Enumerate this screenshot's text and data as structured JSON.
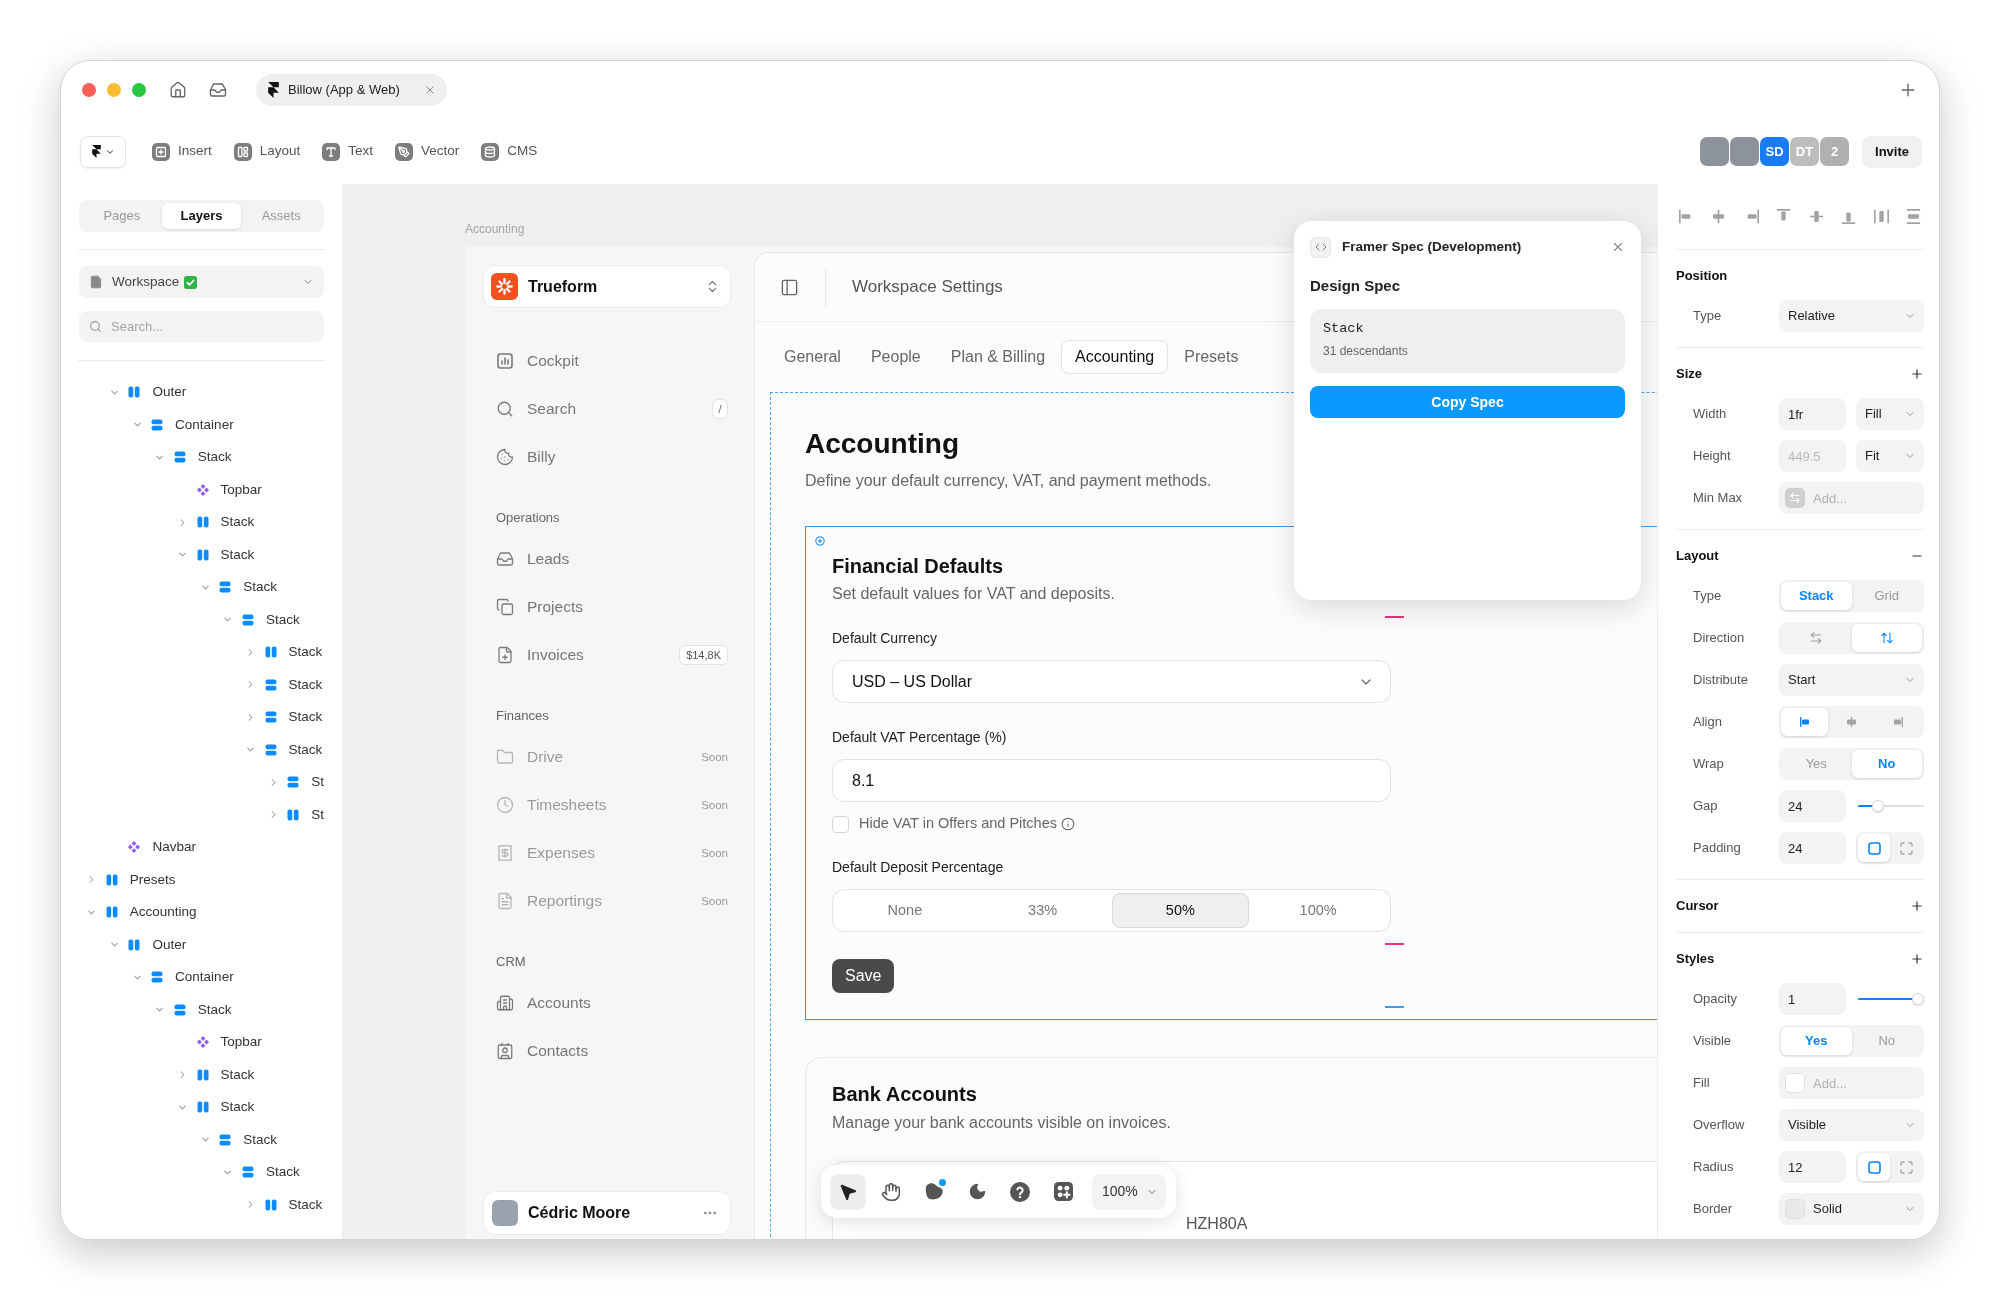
{
  "window": {
    "tab": {
      "title": "Billow (App & Web)"
    }
  },
  "toolbar": {
    "items": [
      {
        "label": "Insert"
      },
      {
        "label": "Layout"
      },
      {
        "label": "Text"
      },
      {
        "label": "Vector"
      },
      {
        "label": "CMS"
      }
    ],
    "collaborators": [
      {
        "kind": "photo"
      },
      {
        "kind": "photo"
      },
      {
        "kind": "initials",
        "label": "SD",
        "color": "#1a7cf5"
      },
      {
        "kind": "initials",
        "label": "DT",
        "color": "#bdbdbd"
      },
      {
        "kind": "count",
        "label": "2",
        "color": "#b0b0b0"
      }
    ],
    "invite": "Invite"
  },
  "left_panel": {
    "tabs": [
      {
        "label": "Pages",
        "selected": false
      },
      {
        "label": "Layers",
        "selected": true
      },
      {
        "label": "Assets",
        "selected": false
      }
    ],
    "page": {
      "value": "Workspace"
    },
    "search": {
      "placeholder": "Search..."
    },
    "layers": [
      {
        "children": [
          {
            "name": "Outer",
            "kind": "hstack",
            "expanded": true,
            "children": [
              {
                "name": "Container",
                "kind": "vstack",
                "expanded": true,
                "children": [
                  {
                    "name": "Stack",
                    "kind": "vstack",
                    "expanded": true,
                    "children": [
                      {
                        "name": "Topbar",
                        "kind": "component"
                      },
                      {
                        "name": "Stack",
                        "kind": "hstack",
                        "expanded": false
                      },
                      {
                        "name": "Stack",
                        "kind": "hstack",
                        "expanded": true,
                        "children": [
                          {
                            "name": "Stack",
                            "kind": "vstack",
                            "expanded": true,
                            "children": [
                              {
                                "name": "Stack",
                                "kind": "vstack",
                                "expanded": true,
                                "children": [
                                  {
                                    "name": "Stack",
                                    "kind": "hstack",
                                    "expanded": false
                                  },
                                  {
                                    "name": "Stack",
                                    "kind": "vstack",
                                    "expanded": false
                                  },
                                  {
                                    "name": "Stack",
                                    "kind": "vstack",
                                    "expanded": false
                                  },
                                  {
                                    "name": "Stack",
                                    "kind": "vstack",
                                    "expanded": true,
                                    "children": [
                                      {
                                        "name": "St",
                                        "kind": "vstack",
                                        "expanded": false
                                      },
                                      {
                                        "name": "St",
                                        "kind": "hstack",
                                        "expanded": false
                                      }
                                    ]
                                  }
                                ]
                              }
                            ]
                          }
                        ]
                      }
                    ]
                  }
                ]
              }
            ]
          },
          {
            "name": "Navbar",
            "kind": "component"
          }
        ]
      },
      {
        "name": "Presets",
        "kind": "hstack",
        "expanded": false
      },
      {
        "name": "Accounting",
        "kind": "hstack",
        "expanded": true,
        "children": [
          {
            "name": "Outer",
            "kind": "hstack",
            "expanded": true,
            "children": [
              {
                "name": "Container",
                "kind": "vstack",
                "expanded": true,
                "children": [
                  {
                    "name": "Stack",
                    "kind": "vstack",
                    "expanded": true,
                    "children": [
                      {
                        "name": "Topbar",
                        "kind": "component"
                      },
                      {
                        "name": "Stack",
                        "kind": "hstack",
                        "expanded": false
                      },
                      {
                        "name": "Stack",
                        "kind": "hstack",
                        "expanded": true,
                        "children": [
                          {
                            "name": "Stack",
                            "kind": "vstack",
                            "expanded": true,
                            "children": [
                              {
                                "name": "Stack",
                                "kind": "vstack",
                                "expanded": true,
                                "children": [
                                  {
                                    "name": "Stack",
                                    "kind": "hstack",
                                    "expanded": false
                                  }
                                ]
                              }
                            ]
                          }
                        ]
                      }
                    ]
                  }
                ]
              }
            ]
          }
        ]
      }
    ]
  },
  "canvas": {
    "frame_label": "Accounting",
    "app": {
      "sidebar": {
        "workspace": "Trueform",
        "sections": [
          {
            "items": [
              {
                "label": "Cockpit",
                "disabled": false
              },
              {
                "label": "Search",
                "shortcut": "/",
                "disabled": false
              },
              {
                "label": "Billy",
                "disabled": false
              }
            ]
          },
          {
            "heading": "Operations",
            "items": [
              {
                "label": "Leads",
                "disabled": false
              },
              {
                "label": "Projects",
                "disabled": false
              },
              {
                "label": "Invoices",
                "badge": "$14,8K",
                "disabled": false
              }
            ]
          },
          {
            "heading": "Finances",
            "items": [
              {
                "label": "Drive",
                "badge": "Soon",
                "disabled": true
              },
              {
                "label": "Timesheets",
                "badge": "Soon",
                "disabled": true
              },
              {
                "label": "Expenses",
                "badge": "Soon",
                "disabled": true
              },
              {
                "label": "Reportings",
                "badge": "Soon",
                "disabled": true
              }
            ]
          },
          {
            "heading": "CRM",
            "items": [
              {
                "label": "Accounts",
                "disabled": false
              },
              {
                "label": "Contacts",
                "disabled": false
              }
            ]
          }
        ],
        "user": {
          "name": "Cédric Moore"
        }
      },
      "main": {
        "header": {
          "title": "Workspace Settings"
        },
        "tabs": [
          {
            "label": "General",
            "selected": false
          },
          {
            "label": "People",
            "selected": false
          },
          {
            "label": "Plan & Billing",
            "selected": false
          },
          {
            "label": "Accounting",
            "selected": true
          },
          {
            "label": "Presets",
            "selected": false
          }
        ],
        "title": "Accounting",
        "subtitle": "Define your default currency, VAT, and payment methods.",
        "financial_defaults": {
          "title": "Financial Defaults",
          "subtitle": "Set default values for VAT and deposits.",
          "currency": {
            "label": "Default Currency",
            "value": "USD – US Dollar"
          },
          "vat": {
            "label": "Default VAT Percentage (%)",
            "value": "8.1"
          },
          "hide_vat": {
            "label": "Hide VAT in Offers and Pitches",
            "checked": false
          },
          "deposit": {
            "label": "Default Deposit Percentage",
            "options": [
              {
                "label": "None",
                "selected": false
              },
              {
                "label": "33%",
                "selected": false
              },
              {
                "label": "50%",
                "selected": true
              },
              {
                "label": "100%",
                "selected": false
              }
            ]
          },
          "save": "Save"
        },
        "bank_accounts": {
          "title": "Bank Accounts",
          "subtitle": "Manage your bank accounts visible on invoices.",
          "row_fragment": "HZH80A"
        }
      }
    },
    "spec_popup": {
      "title": "Framer Spec (Development)",
      "heading": "Design Spec",
      "layer": {
        "name": "Stack",
        "meta": "31 descendants"
      },
      "button": "Copy Spec"
    },
    "toolbar": {
      "tools": [
        {
          "kind": "pointer",
          "selected": true,
          "dot": false
        },
        {
          "kind": "hand",
          "selected": false,
          "dot": false
        },
        {
          "kind": "shape",
          "selected": false,
          "dot": true
        },
        {
          "kind": "moon",
          "selected": false,
          "dot": false
        },
        {
          "kind": "help",
          "selected": false,
          "dot": false
        },
        {
          "kind": "plugins",
          "selected": false,
          "dot": false
        }
      ],
      "zoom": "100%"
    }
  },
  "right_panel": {
    "sections": [
      {
        "title": "Position",
        "rows": [
          {
            "kind": "select",
            "label": "Type",
            "value": "Relative"
          }
        ]
      },
      {
        "title": "Size",
        "applied": false,
        "rows": [
          {
            "kind": "input-select",
            "label": "Width",
            "value": "1fr",
            "option": "Fill"
          },
          {
            "kind": "input-select",
            "label": "Height",
            "placeholder": "449.5",
            "option": "Fit"
          },
          {
            "kind": "add",
            "label": "Min Max",
            "placeholder": "Add..."
          }
        ]
      },
      {
        "title": "Layout",
        "applied": true,
        "rows": [
          {
            "kind": "segmented",
            "label": "Type",
            "options": [
              {
                "label": "Stack",
                "selected": true
              },
              {
                "label": "Grid",
                "selected": false
              }
            ]
          },
          {
            "kind": "direction",
            "label": "Direction",
            "options": [
              {
                "selected": false
              },
              {
                "selected": true
              }
            ]
          },
          {
            "kind": "select",
            "label": "Distribute",
            "value": "Start"
          },
          {
            "kind": "align",
            "label": "Align",
            "options": [
              {
                "selected": true
              },
              {
                "selected": false
              },
              {
                "selected": false
              }
            ]
          },
          {
            "kind": "segmented",
            "label": "Wrap",
            "options": [
              {
                "label": "Yes",
                "selected": false
              },
              {
                "label": "No",
                "selected": true
              }
            ]
          },
          {
            "kind": "input-slider",
            "label": "Gap",
            "value": "24",
            "level": 0.25
          },
          {
            "kind": "input-toggle",
            "label": "Padding",
            "value": "24",
            "options": [
              {
                "selected": true
              },
              {
                "selected": false
              }
            ]
          }
        ]
      },
      {
        "title": "Cursor",
        "applied": false
      },
      {
        "title": "Styles",
        "applied": false,
        "rows": [
          {
            "kind": "input-slider",
            "label": "Opacity",
            "value": "1",
            "level": 1
          },
          {
            "kind": "segmented",
            "label": "Visible",
            "options": [
              {
                "label": "Yes",
                "selected": true
              },
              {
                "label": "No",
                "selected": false
              }
            ]
          },
          {
            "kind": "swatch-add",
            "label": "Fill",
            "placeholder": "Add..."
          },
          {
            "kind": "select",
            "label": "Overflow",
            "value": "Visible"
          },
          {
            "kind": "input-toggle",
            "label": "Radius",
            "value": "12",
            "options": [
              {
                "selected": true
              },
              {
                "selected": false
              }
            ]
          },
          {
            "kind": "swatch-select",
            "label": "Border",
            "value": "Solid"
          }
        ]
      }
    ]
  }
}
